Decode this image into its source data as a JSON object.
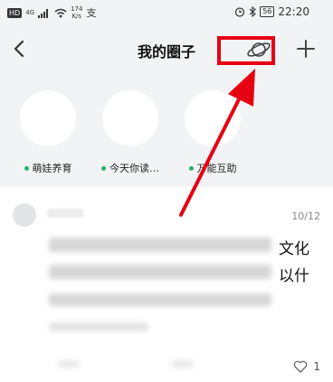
{
  "status_bar": {
    "network_badge": "HD",
    "net_tag": "4G",
    "speed_value": "174",
    "speed_unit": "K/s",
    "extra_icon": "支",
    "battery": "56",
    "time": "22:20"
  },
  "header": {
    "title": "我的圈子",
    "back_icon": "chevron-left-icon",
    "planet_icon": "planet-icon",
    "add_icon": "plus-icon"
  },
  "circles": [
    {
      "label": "萌娃养育"
    },
    {
      "label": "今天你读…"
    },
    {
      "label": "万能互助"
    }
  ],
  "post": {
    "date": "10/12",
    "visible_text_1": "文化",
    "visible_text_2": "以什",
    "like_count": "1"
  },
  "colors": {
    "highlight": "#e60012",
    "status_dot": "#27b36b",
    "background": "#f2f3f5"
  }
}
